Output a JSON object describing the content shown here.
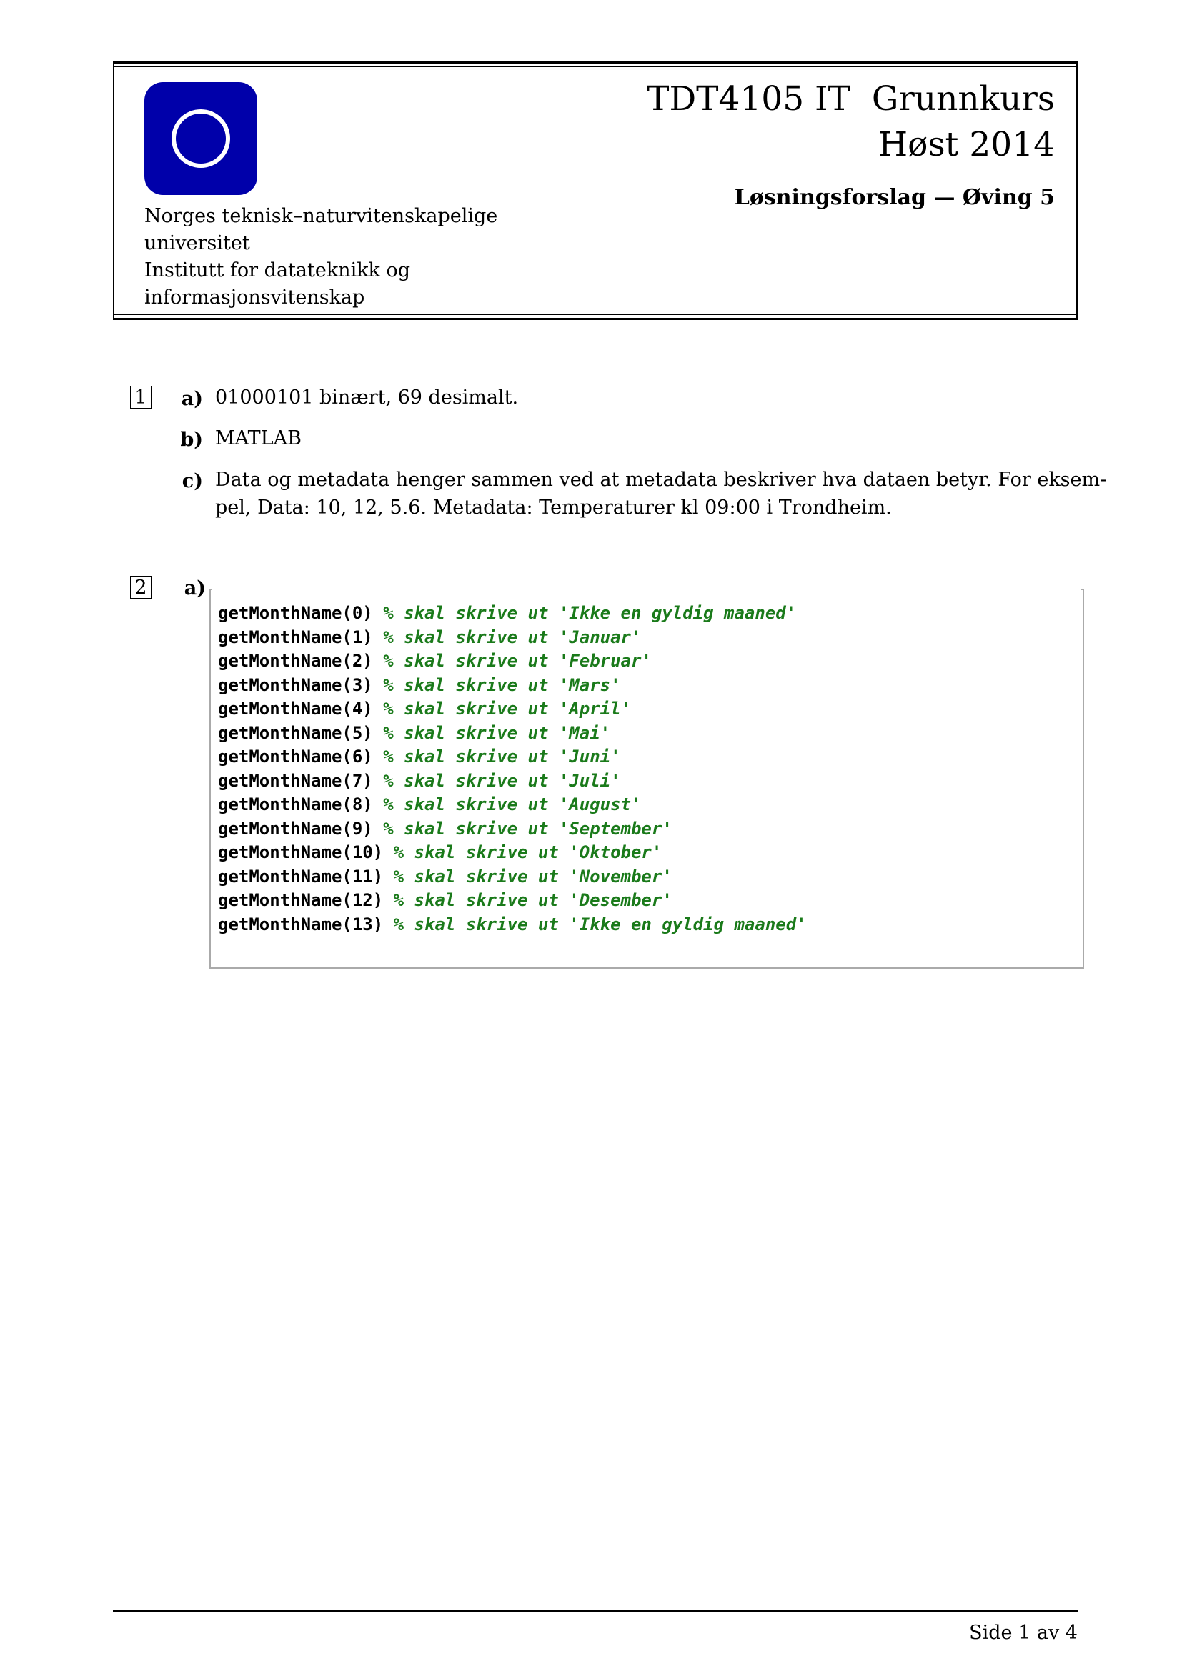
{
  "header": {
    "university": [
      "Norges teknisk–naturvitenskapelige",
      "universitet",
      "Institutt for datateknikk og",
      "informasjonsvitenskap"
    ],
    "course_line": "TDT4105 IT  Grunnkurs",
    "semester": "Høst 2014",
    "subtitle": "Løsningsforslag — Øving 5",
    "logo": "ntnu-logo"
  },
  "problem1": {
    "number": "1",
    "a": {
      "label": "a)",
      "text": "01000101 binært, 69 desimalt."
    },
    "b": {
      "label": "b)",
      "text": "MATLAB"
    },
    "c": {
      "label": "c)",
      "line1": "Data og metadata henger sammen ved at metadata beskriver hva dataen betyr. For eksem-",
      "line2": "pel, Data: 10, 12, 5.6. Metadata: Temperaturer kl 09:00 i Trondheim."
    }
  },
  "problem2": {
    "number": "2",
    "a": {
      "label": "a)"
    },
    "code": [
      {
        "call": "getMonthName(0)",
        "comment": "% skal skrive ut 'Ikke en gyldig maaned'"
      },
      {
        "call": "getMonthName(1)",
        "comment": "% skal skrive ut 'Januar'"
      },
      {
        "call": "getMonthName(2)",
        "comment": "% skal skrive ut 'Februar'"
      },
      {
        "call": "getMonthName(3)",
        "comment": "% skal skrive ut 'Mars'"
      },
      {
        "call": "getMonthName(4)",
        "comment": "% skal skrive ut 'April'"
      },
      {
        "call": "getMonthName(5)",
        "comment": "% skal skrive ut 'Mai'"
      },
      {
        "call": "getMonthName(6)",
        "comment": "% skal skrive ut 'Juni'"
      },
      {
        "call": "getMonthName(7)",
        "comment": "% skal skrive ut 'Juli'"
      },
      {
        "call": "getMonthName(8)",
        "comment": "% skal skrive ut 'August'"
      },
      {
        "call": "getMonthName(9)",
        "comment": "% skal skrive ut 'September'"
      },
      {
        "call": "getMonthName(10)",
        "comment": "% skal skrive ut 'Oktober'"
      },
      {
        "call": "getMonthName(11)",
        "comment": "% skal skrive ut 'November'"
      },
      {
        "call": "getMonthName(12)",
        "comment": "% skal skrive ut 'Desember'"
      },
      {
        "call": "getMonthName(13)",
        "comment": "% skal skrive ut 'Ikke en gyldig maaned'"
      }
    ]
  },
  "footer": {
    "page": "Side 1 av 4"
  },
  "colors": {
    "logo_blue": "#0000aa",
    "comment_green": "#1a7a1a"
  }
}
